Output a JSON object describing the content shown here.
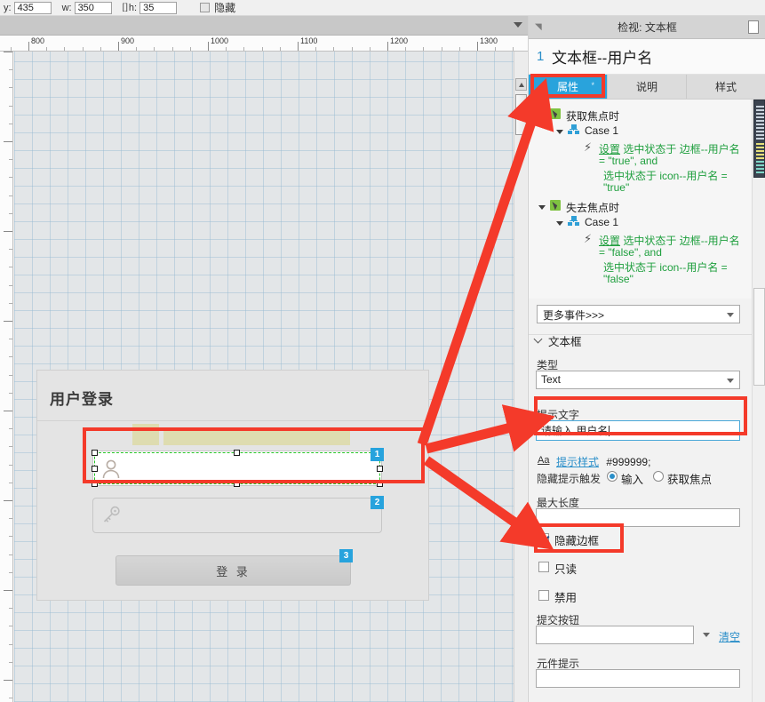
{
  "toolbar": {
    "y_label": "y:",
    "y_value": "435",
    "w_label": "w:",
    "w_value": "350",
    "lock_icon": "link-icon",
    "h_label": "h:",
    "h_value": "35",
    "hidden_label": "隐藏"
  },
  "canvas": {
    "ruler_labels": [
      "800",
      "900",
      "1000",
      "1100",
      "1200",
      "1300"
    ],
    "login": {
      "title": "用户登录",
      "username_icon": "user-icon",
      "username_value": "",
      "password_icon": "key-icon",
      "password_value": "",
      "submit_label": "登 录",
      "badges": [
        "1",
        "2",
        "3"
      ]
    }
  },
  "inspector": {
    "header": "检视: 文本框",
    "widget_index": "1",
    "widget_name": "文本框--用户名",
    "tabs": [
      {
        "label": "属性",
        "active": true,
        "star": "*"
      },
      {
        "label": "说明",
        "active": false,
        "star": ""
      },
      {
        "label": "样式",
        "active": false,
        "star": ""
      }
    ],
    "events": [
      {
        "name": "获取焦点时",
        "case": "Case 1",
        "action_prefix": "设置",
        "action_lines": [
          "选中状态于 边框--用户名",
          "= \"true\", and",
          "选中状态于 icon--用户名 =",
          "\"true\""
        ]
      },
      {
        "name": "失去焦点时",
        "case": "Case 1",
        "action_prefix": "设置",
        "action_lines": [
          "选中状态于 边框--用户名",
          "= \"false\", and",
          "选中状态于 icon--用户名 =",
          "\"false\""
        ]
      }
    ],
    "more_events": "更多事件>>>",
    "section_title": "文本框",
    "type_label": "类型",
    "type_value": "Text",
    "hint_label": "提示文字",
    "hint_value": "请输入 用户名",
    "hint_style_icon": "aa-icon",
    "hint_style_link": "提示样式",
    "hint_style_color": "#999999;",
    "hide_hint_label": "隐藏提示触发",
    "hide_hint_options": [
      {
        "label": "输入",
        "selected": true
      },
      {
        "label": "获取焦点",
        "selected": false
      }
    ],
    "maxlen_label": "最大长度",
    "maxlen_value": "",
    "checkboxes": [
      {
        "label": "隐藏边框",
        "checked": true
      },
      {
        "label": "只读",
        "checked": false
      },
      {
        "label": "禁用",
        "checked": false
      }
    ],
    "submit_btn_label": "提交按钮",
    "submit_btn_value": "",
    "clear_link": "清空",
    "tooltip_label": "元件提示",
    "tooltip_value": ""
  },
  "colors": {
    "accent": "#29a3dc",
    "highlight": "#f43a2a",
    "selection": "#24c425",
    "action_green": "#1f9f3e"
  }
}
